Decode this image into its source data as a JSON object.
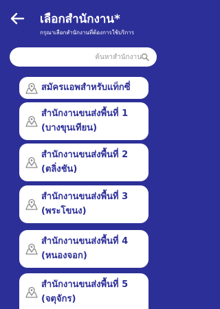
{
  "header": {
    "title": "เลือกสำนักงาน*",
    "subtitle": "กรุณาเลือกสำนักงานที่ต้องการใช้บริการ"
  },
  "search": {
    "placeholder": "ค้นหาสำนักงาน"
  },
  "offices": [
    {
      "line1": "สมัครแอพสำหรับแท็กซี่",
      "line2": ""
    },
    {
      "line1": "สำนักงานขนส่งพื้นที่ 1",
      "line2": "(บางขุนเทียน)"
    },
    {
      "line1": "สำนักงานขนส่งพื้นที่ 2",
      "line2": "(ตลิ่งชัน)"
    },
    {
      "line1": "สำนักงานขนส่งพื้นที่ 3",
      "line2": "(พระโขนง)"
    },
    {
      "line1": "สำนักงานขนส่งพื้นที่ 4",
      "line2": "(หนองจอก)"
    },
    {
      "line1": "สำนักงานขนส่งพื้นที่ 5",
      "line2": "(จตุจักร)"
    }
  ],
  "colors": {
    "background": "#2d2f98",
    "card": "#ffffff",
    "text_accent": "#2d2f98",
    "icon": "#8a8a8a"
  },
  "icons": {
    "back": "arrow-left-icon",
    "search": "magnifier-icon",
    "office": "location-pin-map-icon"
  }
}
